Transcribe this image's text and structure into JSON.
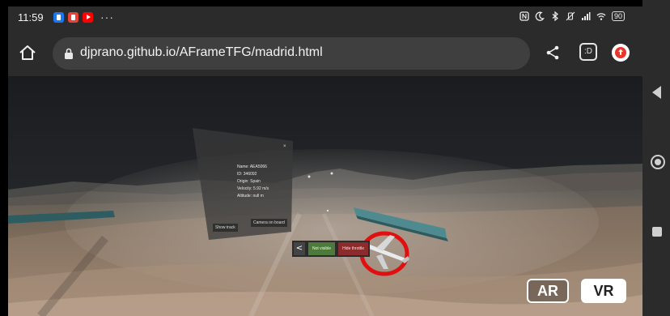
{
  "status_bar": {
    "time": "11:59",
    "notification_icons": [
      "facebook-icon",
      "gmail-icon",
      "youtube-icon"
    ],
    "more": "···",
    "battery": "90"
  },
  "browser": {
    "url": "djprano.github.io/AFrameTFG/madrid.html",
    "extension_label": ":D"
  },
  "scene": {
    "flight_info": {
      "name": "Name: AEA5066",
      "id": "ID: 346092",
      "origin": "Origin: Spain",
      "velocity": "Velocity: 5.92 m/s",
      "altitude": "Altitude: null m"
    },
    "close": "×",
    "show_track_label": "Show track",
    "camera_label": "Camera on board",
    "hud": {
      "back": "<",
      "follow": "Not visible",
      "hide": "Hide throttle"
    },
    "ar_label": "AR",
    "vr_label": "VR"
  },
  "colors": {
    "chrome_bg": "#2b2b2b",
    "follow_green": "#4d7a3a",
    "hide_red": "#8b2b2b",
    "target_ring": "#e01010"
  }
}
